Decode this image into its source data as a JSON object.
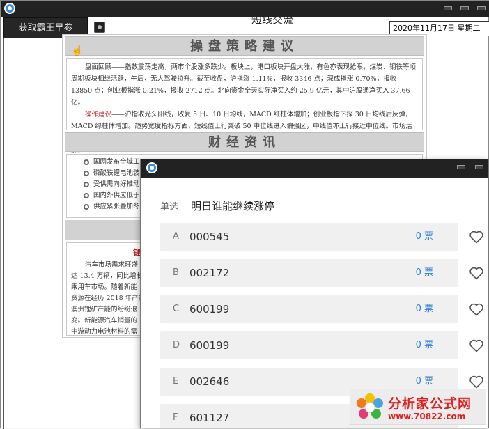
{
  "background_window": {
    "title": "短线交流",
    "fetch_button": "获取霸王早参",
    "date_display": "2020年11月17日  星期二",
    "strategy": {
      "heading": "操盘策略建议",
      "review_text": "盘面回顾——指数震荡走高，两市个股涨多跌少。板块上，港口板块开盘大涨，有色亦表现抢眼，煤炭、钢铁等顺周期板块相继活跃，午后，无人驾驶拉升。截至收盘，沪指涨 1.11%，报收 3346 点；深成指涨 0.70%，报收 13850 点；创业板指涨 0.21%，报收 2712 点。北向资金全天实际净买入约 25.9 亿元，其中沪股通净买入 37.66 亿。",
      "advice_label": "操作建议",
      "advice_text": "——沪指收光头阳线，收复 5 日、10 日均线，MACD 红柱体增加；创业板指下探 30 日均线后反弹，MACD 绿柱体增加。趋势宽度指标方面，短线值上行突破 50 中位线进入偏强区，中线值亦上行接近中位线。市场活跃度有所提升，年底资金调仓换股，市场风格切换，短期继续留意涨价类题材中优质个股的低吸机会，但切忌盲目追涨。"
    },
    "news": {
      "heading": "财经资讯",
      "items": [
        "国网发布全域工",
        "磷酸铁锂电池装",
        "受供需向好推动",
        "国内外供应低于",
        "供应紧张叠加冬"
      ]
    },
    "article": {
      "title": "锂资",
      "lines": [
        "汽车市场需求旺盛",
        "达 13.4 万辆，同比增长",
        "乘用车市场。随着新能",
        "资源在经历 2018 年产能",
        "澳洲锂矿产能的纷纷退",
        "变。新能源汽车销量的",
        "中游动力电池材料的需"
      ]
    }
  },
  "vote_dialog": {
    "type_label": "单选",
    "question": "明日谁能继续涨停",
    "options": [
      {
        "letter": "A",
        "code": "000545",
        "votes": "0 票"
      },
      {
        "letter": "B",
        "code": "002172",
        "votes": "0 票"
      },
      {
        "letter": "C",
        "code": "600199",
        "votes": "0 票"
      },
      {
        "letter": "D",
        "code": "600199",
        "votes": "0 票"
      },
      {
        "letter": "E",
        "code": "002646",
        "votes": "0 票"
      },
      {
        "letter": "F",
        "code": "601127",
        "votes": ""
      }
    ]
  },
  "watermark": {
    "name": "分析家公式网",
    "url": "www.70822.com"
  },
  "colors": {
    "vote_count": "#2e7fd6",
    "titlebar": "#222222",
    "highlight_red": "#c02020"
  }
}
